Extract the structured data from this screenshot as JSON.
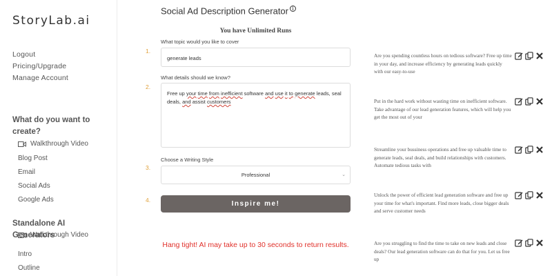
{
  "sidebar": {
    "logo": "StoryLab.ai",
    "links": [
      "Logout",
      "Pricing/Upgrade",
      "Manage Account"
    ],
    "section1_title": "What do you want to create?",
    "section1_items": [
      "Walkthrough Video",
      "Blog Post",
      "Email",
      "Social Ads",
      "Google Ads"
    ],
    "section2_title": "Standalone AI Generators",
    "section2_items": [
      "Walkthrough Video",
      "Intro",
      "Outline"
    ]
  },
  "main": {
    "title": "Social Ad Description Generator",
    "info_icon": "i",
    "runs": "You have Unlimited Runs",
    "steps": [
      "1.",
      "2.",
      "3.",
      "4."
    ],
    "topic_label": "What topic would you like to cover",
    "topic_value": "generate leads",
    "details_label": "What details should we know?",
    "details_parts": [
      "Free up ",
      "your",
      " ",
      "time",
      " ",
      "from",
      " ",
      "inefficient",
      " software ",
      "and",
      " ",
      "use",
      " ",
      "it",
      " ",
      "to",
      " ",
      "generate",
      " leads, seal deals, ",
      "and",
      " assist ",
      "customers"
    ],
    "style_label": "Choose a Writing Style",
    "style_value": "Professional",
    "inspire_button": "Inspire me!",
    "hang_tight": "Hang tight! AI may take up to 30 seconds to return results."
  },
  "results": [
    "Are you spending countless hours on tedious software? Free up time in your day, and increase efficiency by generating leads quickly with our easy-to-use",
    "Put in the hard work without wasting time on inefficient software. Take advantage of our lead generation features, which will help you get the most out of your",
    "Streamline your bussiness operations and free up valuable time to generate leads, seal deals, and build relationships with customers. Automate tedious tasks with",
    "Unlock the power of efficient lead generation software and free up your time for what's important. Find more leads, close bigger deals and serve customer needs",
    "Are you struggling to find the time to take on new leads and close deals? Our lead generation software can do that for you.  Let us free up"
  ],
  "colors": {
    "accent": "#e0a03a",
    "button": "#6b6563",
    "warning": "#e0302a"
  }
}
